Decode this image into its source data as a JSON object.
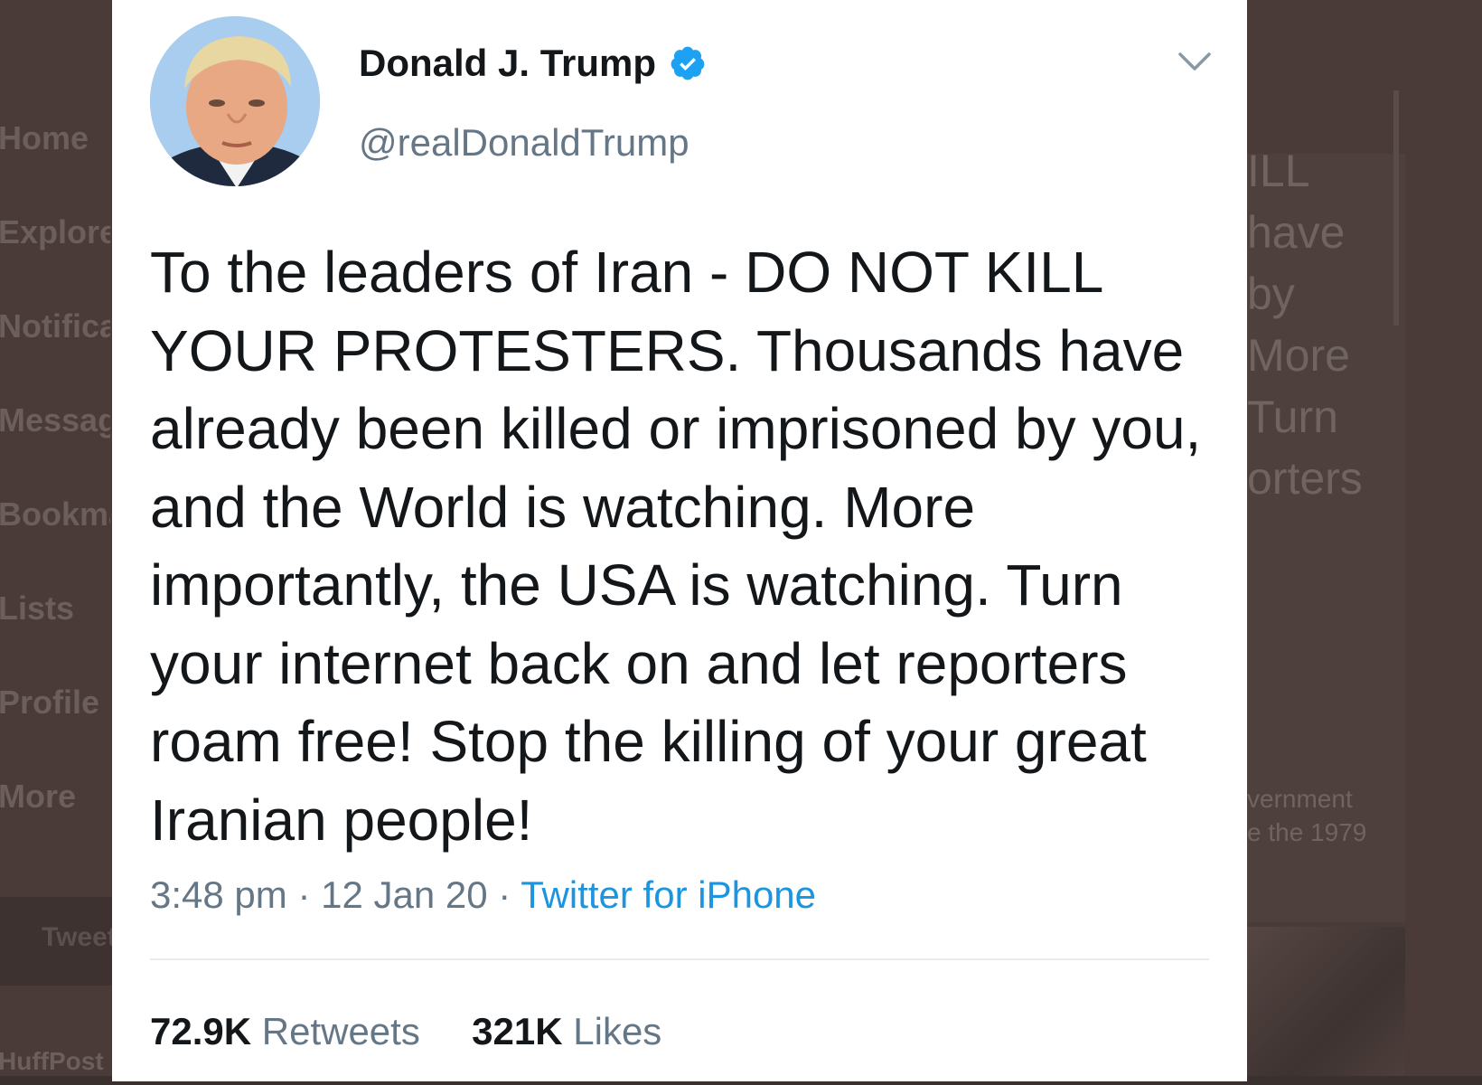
{
  "background": {
    "nav_items": [
      "Home",
      "Explore",
      "Notifications",
      "Messages",
      "Bookmarks",
      "Lists",
      "Profile",
      "More"
    ],
    "tweet_button_label": "Tweet",
    "bottom_left_fragment": "HuffPost",
    "right_fragments": [
      "ILL",
      "have",
      "by",
      "More",
      "Turn",
      "orters"
    ],
    "right_small_fragments": [
      "vernment",
      "e the 1979"
    ]
  },
  "tweet": {
    "author_name": "Donald J. Trump",
    "author_handle": "@realDonaldTrump",
    "verified": true,
    "text": "To the leaders of Iran - DO NOT KILL YOUR PROTESTERS. Thousands have already been killed or imprisoned by you, and the World is watching. More importantly, the USA is watching. Turn your internet back on and let reporters roam free! Stop the killing of your great Iranian people!",
    "time": "3:48 pm",
    "date": "12 Jan 20",
    "separator": "·",
    "source": "Twitter for iPhone",
    "retweets_count": "72.9K",
    "retweets_label": "Retweets",
    "likes_count": "321K",
    "likes_label": "Likes"
  },
  "colors": {
    "accent": "#1b95e0",
    "text_primary": "#14171a",
    "text_secondary": "#657786",
    "overlay": "#4a3b38"
  },
  "icons": {
    "verified": "verified-badge-icon",
    "menu": "chevron-down-icon"
  }
}
